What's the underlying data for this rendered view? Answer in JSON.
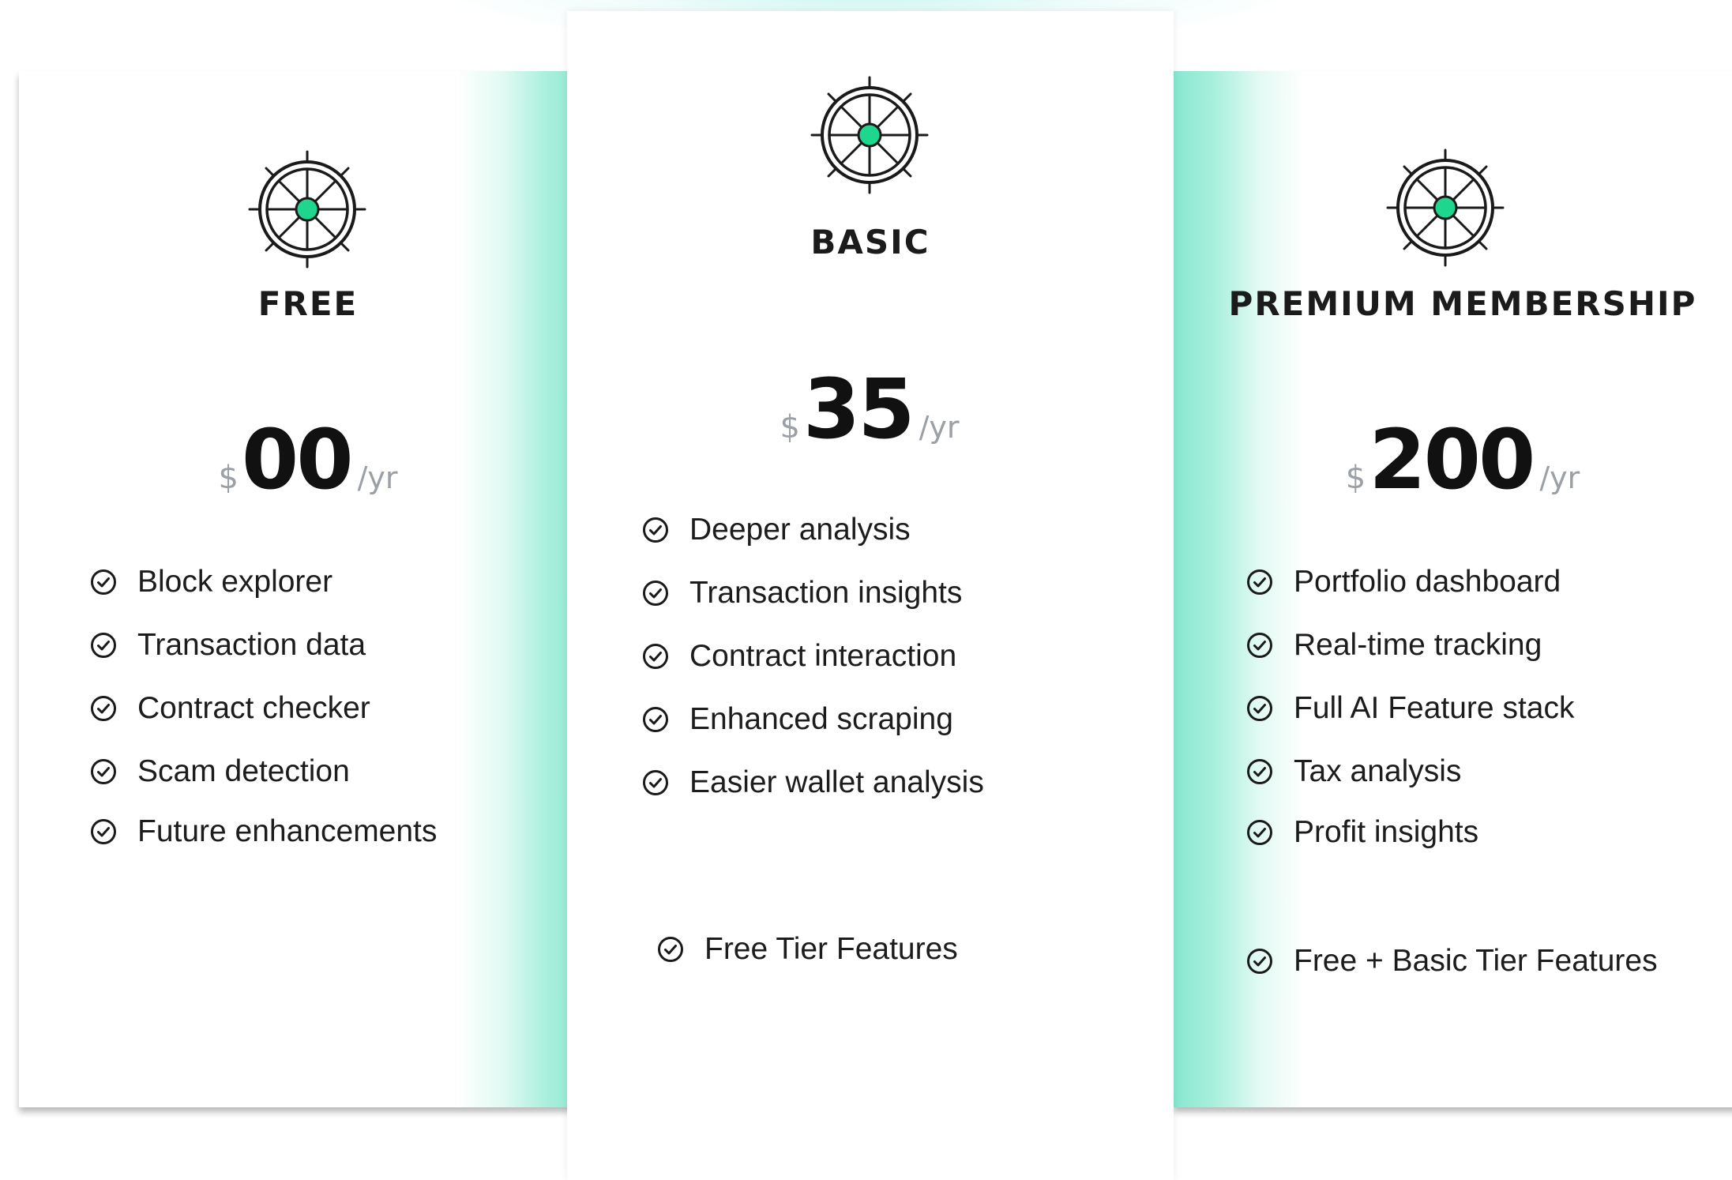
{
  "colors": {
    "accent": "#1fd68e",
    "glow": "#87e7cf",
    "text": "#1c1c1c",
    "muted": "#9aa0a6"
  },
  "icons": {
    "plan_icon": "ship-wheel-icon",
    "feature_icon": "check-circle-icon"
  },
  "plans": [
    {
      "title": "FREE",
      "currency": "$",
      "amount": "00",
      "period": "/yr",
      "features": [
        "Block explorer",
        "Transaction data",
        "Contract checker",
        "Scam detection",
        "Future enhancements"
      ]
    },
    {
      "title": "BASIC",
      "currency": "$",
      "amount": "35",
      "period": "/yr",
      "features": [
        "Deeper analysis",
        "Transaction insights",
        "Contract interaction",
        "Enhanced scraping",
        "Easier wallet analysis"
      ],
      "extra_feature": "Free Tier Features"
    },
    {
      "title": "PREMIUM MEMBERSHIP",
      "currency": "$",
      "amount": "200",
      "period": "/yr",
      "features": [
        "Portfolio dashboard",
        "Real-time tracking",
        "Full AI Feature stack",
        "Tax analysis",
        "Profit insights"
      ],
      "extra_feature": "Free + Basic Tier Features"
    }
  ]
}
